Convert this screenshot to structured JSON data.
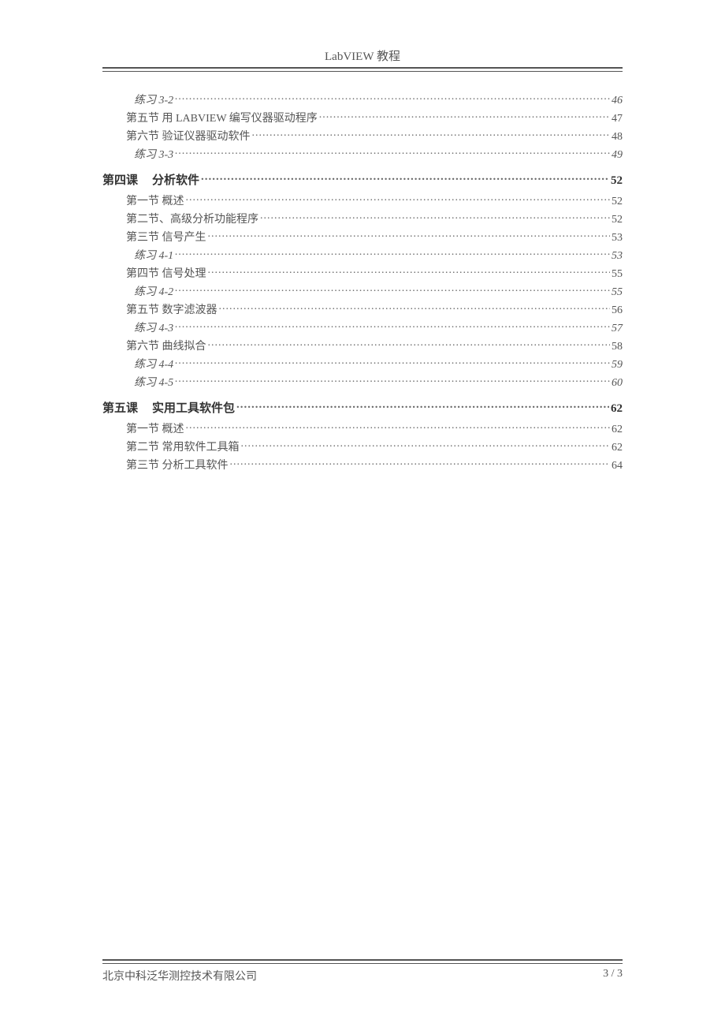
{
  "header": {
    "title": "LabVIEW 教程"
  },
  "toc": [
    {
      "level": "level2",
      "label": "练习 3-2",
      "page": "46"
    },
    {
      "level": "level1",
      "label": "第五节  用 LABVIEW 编写仪器驱动程序",
      "page": "47"
    },
    {
      "level": "level1",
      "label": "第六节  验证仪器驱动软件",
      "page": "48"
    },
    {
      "level": "level2",
      "label": "练习 3-3",
      "page": "49"
    },
    {
      "level": "chapter",
      "label_a": "第四课",
      "label_b": "分析软件",
      "page": "52"
    },
    {
      "level": "level1",
      "label": "第一节  概述",
      "page": "52"
    },
    {
      "level": "level1",
      "label": "第二节、高级分析功能程序",
      "page": "52"
    },
    {
      "level": "level1",
      "label": "第三节  信号产生",
      "page": "53"
    },
    {
      "level": "level2",
      "label": "练习 4-1",
      "page": "53"
    },
    {
      "level": "level1",
      "label": "第四节  信号处理",
      "page": "55"
    },
    {
      "level": "level2",
      "label": "练习 4-2",
      "page": "55"
    },
    {
      "level": "level1",
      "label": "第五节  数字滤波器",
      "page": "56"
    },
    {
      "level": "level2",
      "label": "练习 4-3",
      "page": "57"
    },
    {
      "level": "level1",
      "label": "第六节  曲线拟合",
      "page": "58"
    },
    {
      "level": "level2",
      "label": "练习 4-4",
      "page": "59"
    },
    {
      "level": "level2",
      "label": "练习 4-5",
      "page": "60"
    },
    {
      "level": "chapter",
      "label_a": "第五课",
      "label_b": "实用工具软件包",
      "page": "62"
    },
    {
      "level": "level1",
      "label": "第一节  概述",
      "page": "62"
    },
    {
      "level": "level1",
      "label": "第二节  常用软件工具箱",
      "page": "62"
    },
    {
      "level": "level1",
      "label": "第三节  分析工具软件",
      "page": "64"
    }
  ],
  "footer": {
    "company": "北京中科泛华测控技术有限公司",
    "page": "3 / 3"
  }
}
